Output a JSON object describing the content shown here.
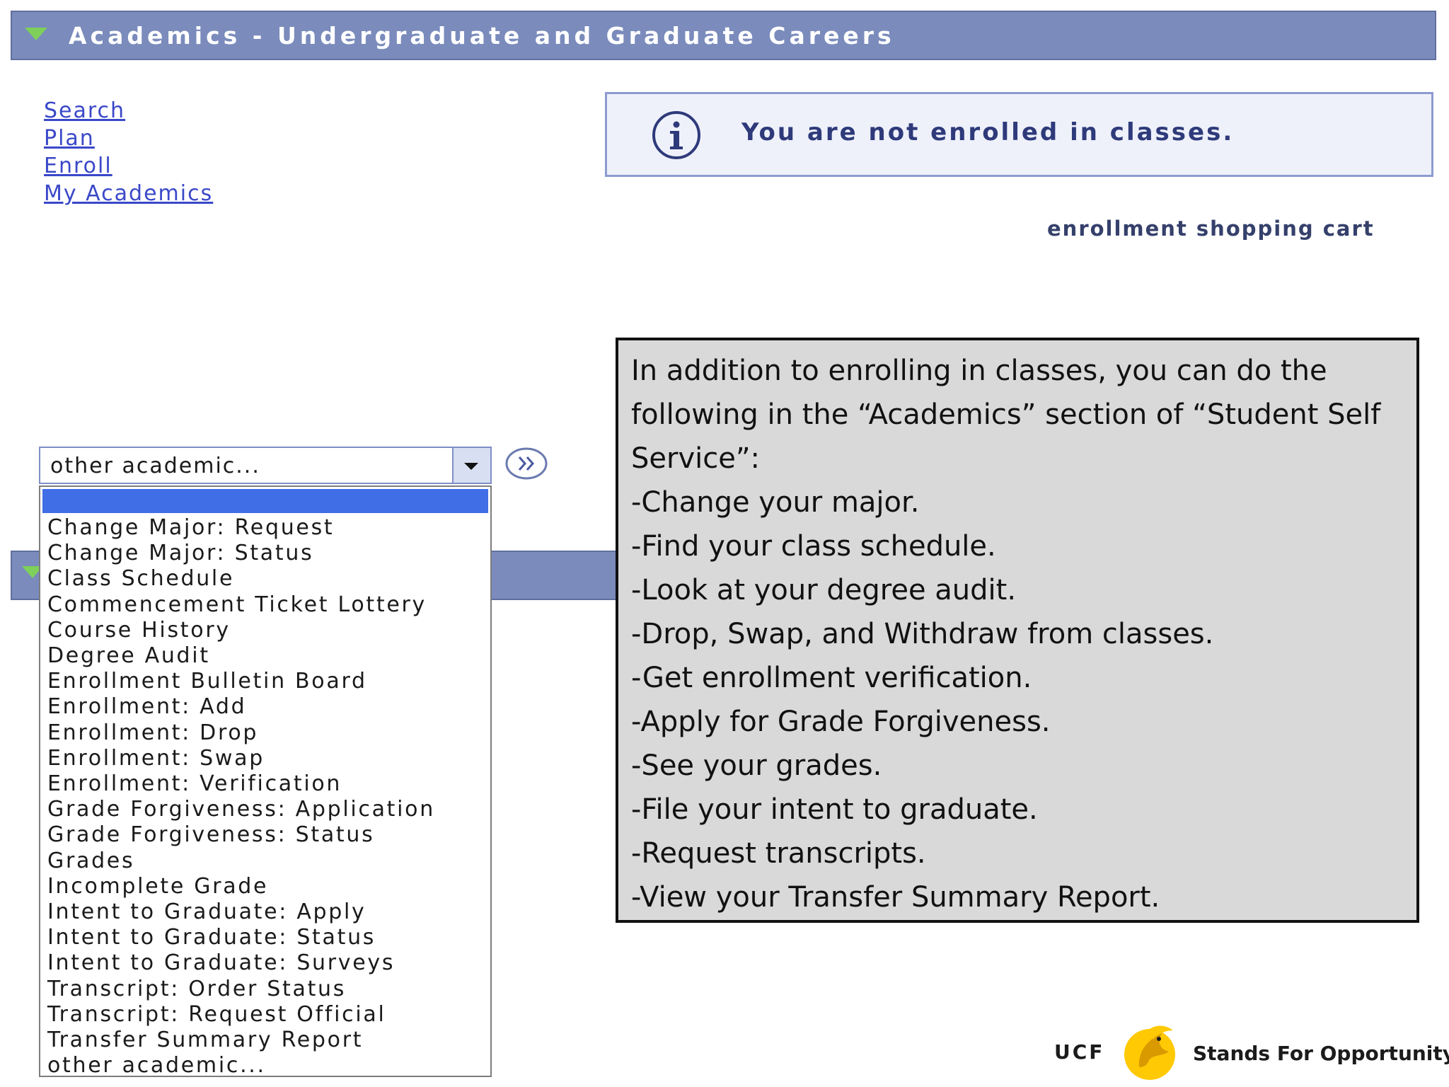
{
  "header": {
    "title": "Academics - Undergraduate and Graduate Careers"
  },
  "nav_links": [
    {
      "label": "Search"
    },
    {
      "label": "Plan"
    },
    {
      "label": "Enroll"
    },
    {
      "label": "My Academics"
    }
  ],
  "notice": {
    "message": "You are not enrolled in classes.",
    "icon": "info-icon"
  },
  "cart_link": "enrollment shopping cart",
  "select": {
    "value": "other academic...",
    "options": [
      "",
      "Change Major: Request",
      "Change Major: Status",
      "Class Schedule",
      "Commencement Ticket Lottery",
      "Course History",
      "Degree Audit",
      "Enrollment Bulletin Board",
      "Enrollment: Add",
      "Enrollment: Drop",
      "Enrollment: Swap",
      "Enrollment: Verification",
      "Grade Forgiveness: Application",
      "Grade Forgiveness: Status",
      "Grades",
      "Incomplete Grade",
      "Intent to Graduate: Apply",
      "Intent to Graduate: Status",
      "Intent to Graduate: Surveys",
      "Transcript: Order Status",
      "Transcript: Request Official",
      "Transfer Summary Report",
      "other academic..."
    ]
  },
  "callout": {
    "intro": "In addition to enrolling in classes, you can do the following in the “Academics” section of “Student Self Service”:",
    "items": [
      "-Change your major.",
      "-Find your class schedule.",
      "-Look at your degree audit.",
      "-Drop, Swap, and Withdraw from classes.",
      "-Get enrollment verification.",
      "-Apply for Grade Forgiveness.",
      "-See your grades.",
      "-File your intent to graduate.",
      "-Request transcripts.",
      "-View your Transfer Summary Report."
    ]
  },
  "footer": {
    "ucf": "UCF",
    "tagline": "Stands For Opportunity"
  },
  "colors": {
    "header": "#7a8bbc",
    "link": "#3a48c8",
    "highlight": "#3f6ee6",
    "callout_bg": "#d9d9d9",
    "ucf_gold": "#ffc904"
  }
}
